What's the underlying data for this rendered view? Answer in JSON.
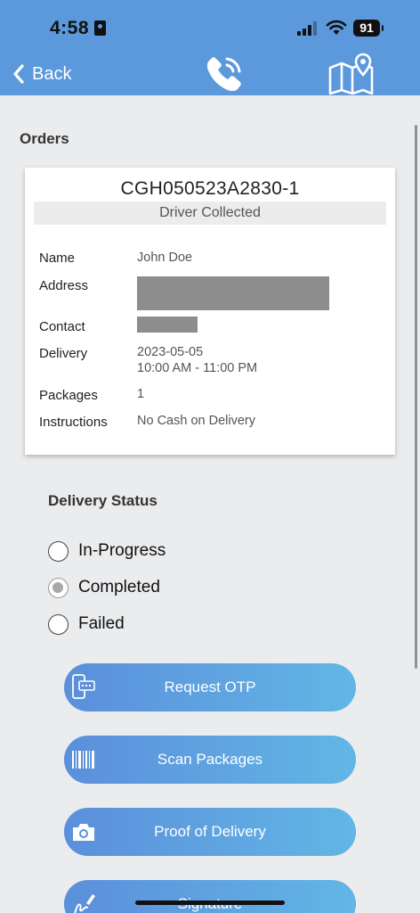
{
  "status_bar": {
    "time": "4:58",
    "battery": "91"
  },
  "header": {
    "back_label": "Back"
  },
  "section_title": "Orders",
  "order": {
    "id": "CGH050523A2830-1",
    "status": "Driver Collected",
    "fields": {
      "name_label": "Name",
      "name_value": "John Doe",
      "address_label": "Address",
      "contact_label": "Contact",
      "delivery_label": "Delivery",
      "delivery_date": "2023-05-05",
      "delivery_window": "10:00 AM - 11:00 PM",
      "packages_label": "Packages",
      "packages_value": "1",
      "instructions_label": "Instructions",
      "instructions_value": "No Cash on Delivery"
    }
  },
  "delivery_status": {
    "title": "Delivery Status",
    "options": [
      {
        "label": "In-Progress",
        "selected": false
      },
      {
        "label": "Completed",
        "selected": true
      },
      {
        "label": "Failed",
        "selected": false
      }
    ]
  },
  "actions": [
    {
      "label": "Request OTP",
      "icon": "otp-phone-icon"
    },
    {
      "label": "Scan Packages",
      "icon": "barcode-icon"
    },
    {
      "label": "Proof of Delivery",
      "icon": "camera-icon"
    },
    {
      "label": "Signature",
      "icon": "signature-icon"
    }
  ],
  "colors": {
    "header_bg": "#5b98dc",
    "button_gradient_start": "#5b8fdb",
    "button_gradient_end": "#62b6e6",
    "page_bg": "#ebecee"
  }
}
